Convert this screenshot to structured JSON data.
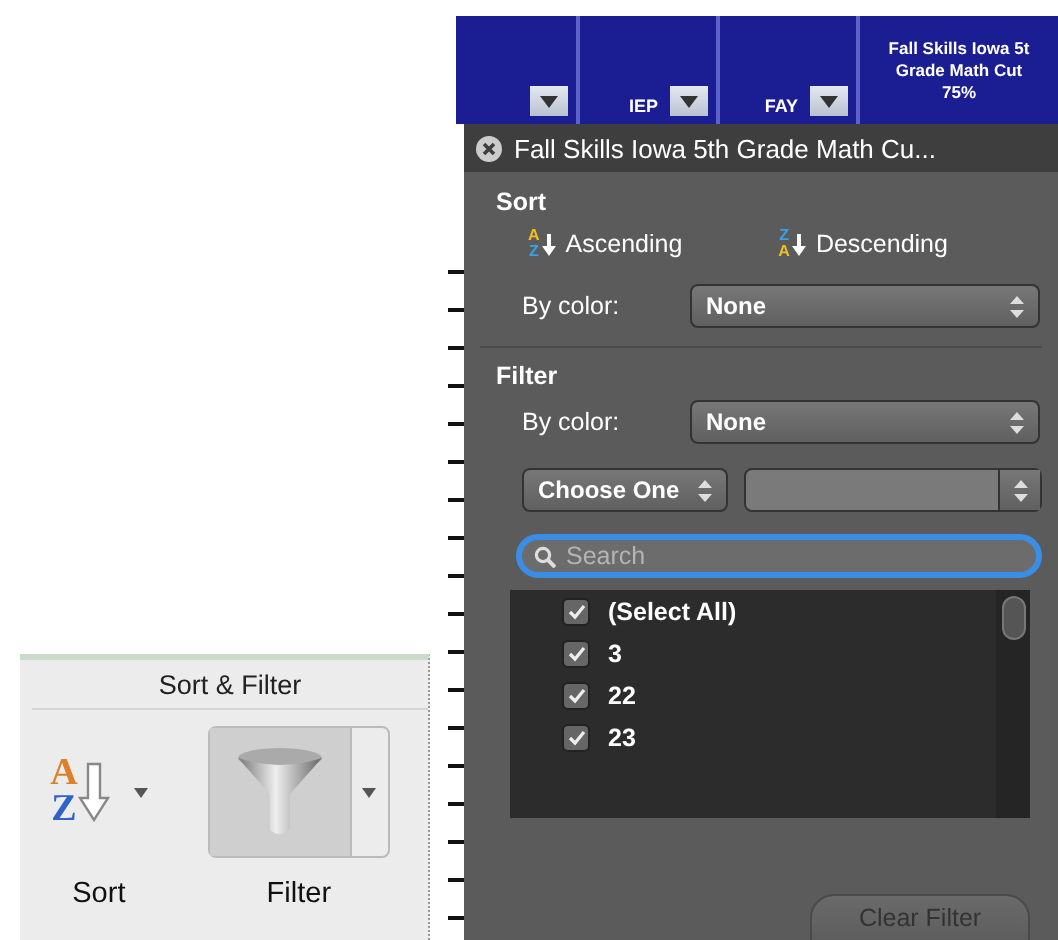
{
  "column_headers": [
    {
      "filter_button": true
    },
    {
      "label": "IEP",
      "filter_button": true
    },
    {
      "label": "FAY",
      "filter_button": true
    },
    {
      "lines": [
        "Fall Skills Iowa 5t",
        "Grade Math Cut",
        "75%"
      ],
      "filter_button": false
    }
  ],
  "filter_panel": {
    "title": "Fall Skills Iowa 5th Grade Math Cu...",
    "sort": {
      "heading": "Sort",
      "buttons": [
        {
          "kind": "ascending",
          "label": "Ascending",
          "icon_top": "A",
          "icon_bottom": "Z"
        },
        {
          "kind": "descending",
          "label": "Descending",
          "icon_top": "Z",
          "icon_bottom": "A"
        }
      ],
      "color_label": "By color:",
      "color_value": "None"
    },
    "filter": {
      "heading": "Filter",
      "color_label": "By color:",
      "color_value": "None",
      "condition": "Choose One",
      "search": {
        "placeholder": "Search",
        "focused": true
      },
      "items": [
        {
          "label": "(Select All)",
          "checked": true
        },
        {
          "label": "3",
          "checked": true
        },
        {
          "label": "22",
          "checked": true
        },
        {
          "label": "23",
          "checked": true
        }
      ]
    },
    "clear_button": {
      "label": "Clear Filter",
      "disabled": true
    }
  },
  "ribbon": {
    "group_title": "Sort & Filter",
    "buttons": [
      {
        "kind": "sort",
        "label": "Sort",
        "selected": false,
        "icon_top": "A",
        "icon_bottom": "Z"
      },
      {
        "kind": "filter",
        "label": "Filter",
        "selected": true
      }
    ]
  }
}
